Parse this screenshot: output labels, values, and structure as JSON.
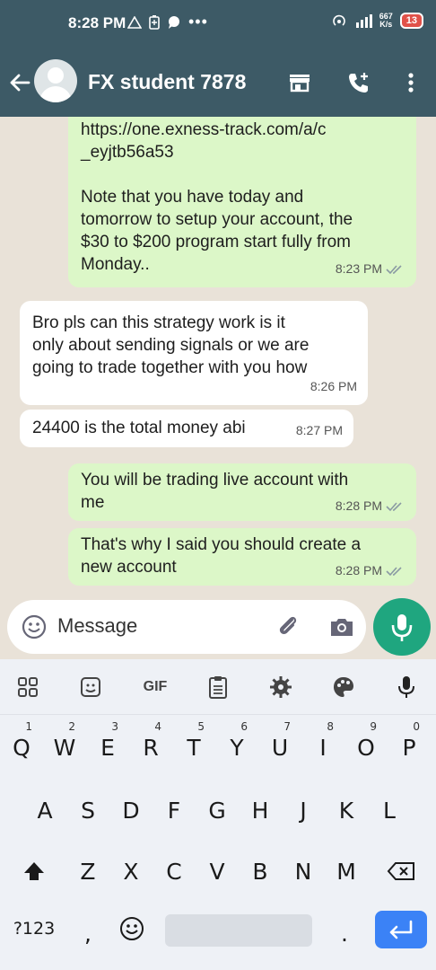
{
  "status_bar": {
    "time": "8:28 PM",
    "net_speed_top": "667",
    "net_speed_bottom": "K/s",
    "battery": "13"
  },
  "header": {
    "contact_name": "FX student 7878"
  },
  "messages": [
    {
      "dir": "out",
      "text": "https://one.exness-track.com/a/c\n_eyjtb56a53\n\nNote that you have today and\ntomorrow to setup your account, the\n$30 to $200 program start fully from\nMonday..",
      "time": "8:23 PM"
    },
    {
      "dir": "in",
      "text": "Bro pls can this strategy work is it\nonly about sending signals or we are\ngoing to trade together with you how",
      "time": "8:26 PM"
    },
    {
      "dir": "in",
      "text": "24400 is the total money abi",
      "time": "8:27 PM"
    },
    {
      "dir": "out",
      "text": "You will be trading live account with\nme",
      "time": "8:28 PM"
    },
    {
      "dir": "out",
      "text": "That's why I said you should create a\nnew account",
      "time": "8:28 PM"
    }
  ],
  "composer": {
    "placeholder": "Message"
  },
  "keyboard": {
    "toolbar_gif": "GIF",
    "row1": [
      {
        "k": "Q",
        "n": "1"
      },
      {
        "k": "W",
        "n": "2"
      },
      {
        "k": "E",
        "n": "3"
      },
      {
        "k": "R",
        "n": "4"
      },
      {
        "k": "T",
        "n": "5"
      },
      {
        "k": "Y",
        "n": "6"
      },
      {
        "k": "U",
        "n": "7"
      },
      {
        "k": "I",
        "n": "8"
      },
      {
        "k": "O",
        "n": "9"
      },
      {
        "k": "P",
        "n": "0"
      }
    ],
    "row2": [
      "A",
      "S",
      "D",
      "F",
      "G",
      "H",
      "J",
      "K",
      "L"
    ],
    "row3": [
      "Z",
      "X",
      "C",
      "V",
      "B",
      "N",
      "M"
    ],
    "symbols_label": "?123",
    "comma": ",",
    "period": "."
  }
}
